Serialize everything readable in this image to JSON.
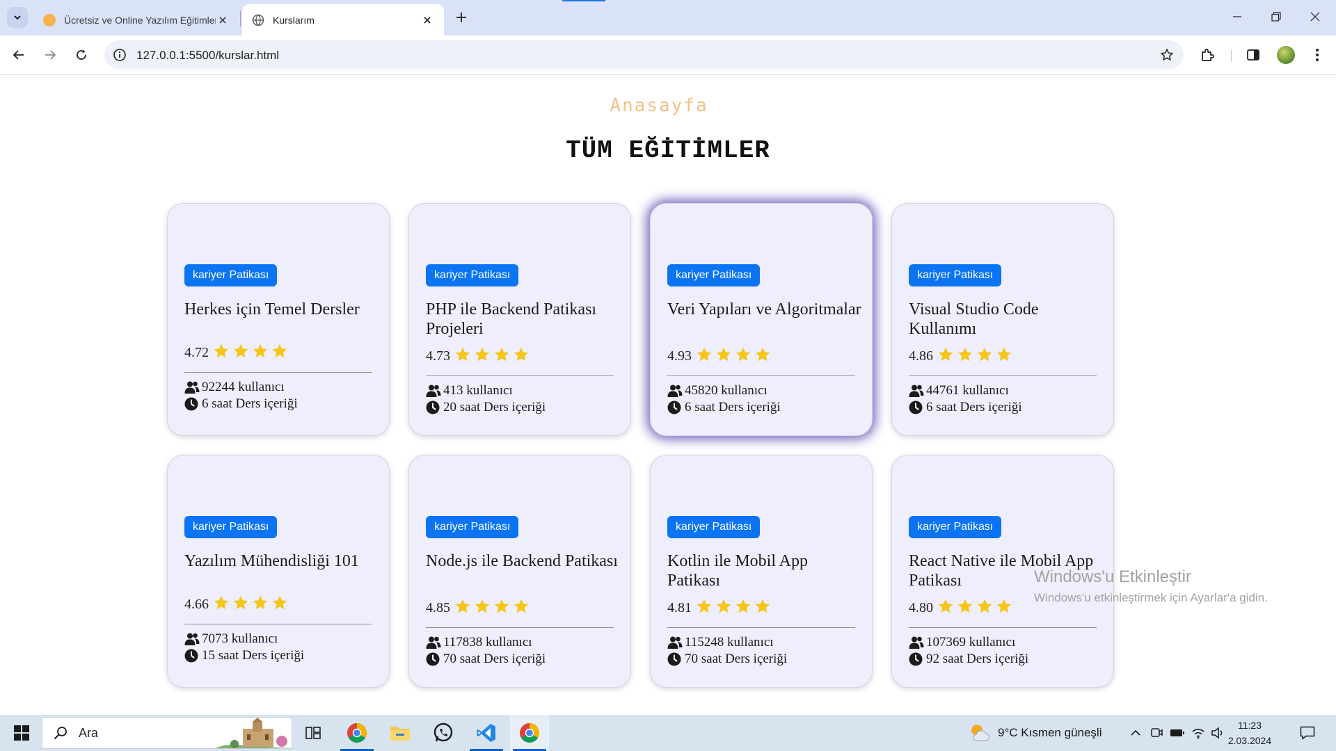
{
  "browser": {
    "tabs": [
      {
        "title": "Ücretsiz ve Online Yazılım Eğitimleri",
        "active": false,
        "favicon_color": "#f6b24a"
      },
      {
        "title": "Kurslarım",
        "active": true,
        "favicon_color": "#5f6368"
      }
    ],
    "url": "127.0.0.1:5500/kurslar.html"
  },
  "page": {
    "home_link": "Anasayfa",
    "title": "TÜM EĞİTİMLER",
    "courses": [
      {
        "badge": "kariyer Patikası",
        "title": "Herkes için Temel Dersler",
        "rating": "4.72",
        "stars": 4,
        "users": "92244 kullanıcı",
        "duration": "6 saat Ders içeriği"
      },
      {
        "badge": "kariyer Patikası",
        "title": "PHP ile Backend Patikası Projeleri",
        "rating": "4.73",
        "stars": 4,
        "users": "413 kullanıcı",
        "duration": "20 saat Ders içeriği"
      },
      {
        "badge": "kariyer Patikası",
        "title": "Veri Yapıları ve Algoritmalar",
        "rating": "4.93",
        "stars": 4,
        "users": "45820 kullanıcı",
        "duration": "6 saat Ders içeriği"
      },
      {
        "badge": "kariyer Patikası",
        "title": "Visual Studio Code Kullanımı",
        "rating": "4.86",
        "stars": 4,
        "users": "44761 kullanıcı",
        "duration": "6 saat Ders içeriği"
      },
      {
        "badge": "kariyer Patikası",
        "title": "Yazılım Mühendisliği 101",
        "rating": "4.66",
        "stars": 4,
        "users": "7073 kullanıcı",
        "duration": "15 saat Ders içeriği"
      },
      {
        "badge": "kariyer Patikası",
        "title": "Node.js ile Backend Patikası",
        "rating": "4.85",
        "stars": 4,
        "users": "117838 kullanıcı",
        "duration": "70 saat Ders içeriği"
      },
      {
        "badge": "kariyer Patikası",
        "title": "Kotlin ile Mobil App Patikası",
        "rating": "4.81",
        "stars": 4,
        "users": "115248 kullanıcı",
        "duration": "70 saat Ders içeriği"
      },
      {
        "badge": "kariyer Patikası",
        "title": "React Native ile Mobil App Patikası",
        "rating": "4.80",
        "stars": 4,
        "users": "107369 kullanıcı",
        "duration": "92 saat Ders içeriği"
      }
    ],
    "colors": {
      "badge": "#0b74f2",
      "star": "#f5c518",
      "card_bg": "#eeeefc",
      "home_link": "#f3c185"
    }
  },
  "watermark": {
    "title": "Windows'u Etkinleştir",
    "subtitle": "Windows'u etkinleştirmek için Ayarlar'a gidin."
  },
  "taskbar": {
    "search_placeholder": "Ara",
    "weather": "9°C  Kısmen güneşli",
    "time": "11:23",
    "date": "2.03.2024",
    "apps": [
      "task-view-icon",
      "chrome-icon",
      "file-explorer-icon",
      "whatsapp-icon",
      "vscode-icon",
      "chrome-icon"
    ]
  }
}
